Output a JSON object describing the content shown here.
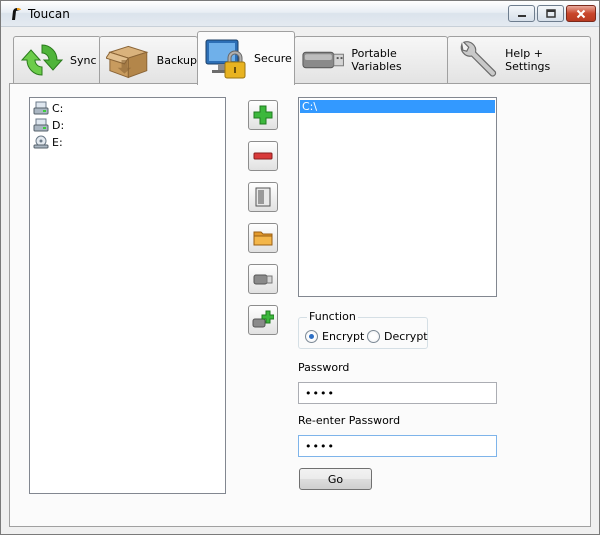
{
  "window": {
    "title": "Toucan"
  },
  "tabs": [
    {
      "label": "Sync",
      "icon": "sync-icon",
      "active": false
    },
    {
      "label": "Backup",
      "icon": "box-icon",
      "active": false
    },
    {
      "label": "Secure",
      "icon": "lock-computer-icon",
      "active": true
    },
    {
      "label": "Portable Variables",
      "icon": "usb-drive-icon",
      "active": false
    },
    {
      "label": "Help + Settings",
      "icon": "wrench-icon",
      "active": false
    }
  ],
  "drives": [
    {
      "label": "C:",
      "icon": "hard-drive-icon"
    },
    {
      "label": "D:",
      "icon": "hard-drive-icon"
    },
    {
      "label": "E:",
      "icon": "cd-drive-icon"
    }
  ],
  "toolbar": [
    {
      "name": "add-button",
      "icon": "plus-icon"
    },
    {
      "name": "remove-button",
      "icon": "minus-icon"
    },
    {
      "name": "add-file-button",
      "icon": "file-icon"
    },
    {
      "name": "add-folder-button",
      "icon": "folder-icon"
    },
    {
      "name": "insert-variable-button",
      "icon": "usb-variable-icon"
    },
    {
      "name": "add-variable-button",
      "icon": "usb-add-icon"
    }
  ],
  "paths": [
    "C:\\"
  ],
  "function": {
    "label": "Function",
    "options": [
      {
        "label": "Encrypt",
        "selected": true
      },
      {
        "label": "Decrypt",
        "selected": false
      }
    ]
  },
  "password": {
    "label": "Password",
    "value": "••••"
  },
  "repeat_password": {
    "label": "Re-enter Password",
    "value": "••••"
  },
  "go_button": {
    "label": "Go"
  },
  "colors": {
    "selection": "#3399ff",
    "accent_green": "#2fa12f",
    "accent_red": "#d03030"
  }
}
